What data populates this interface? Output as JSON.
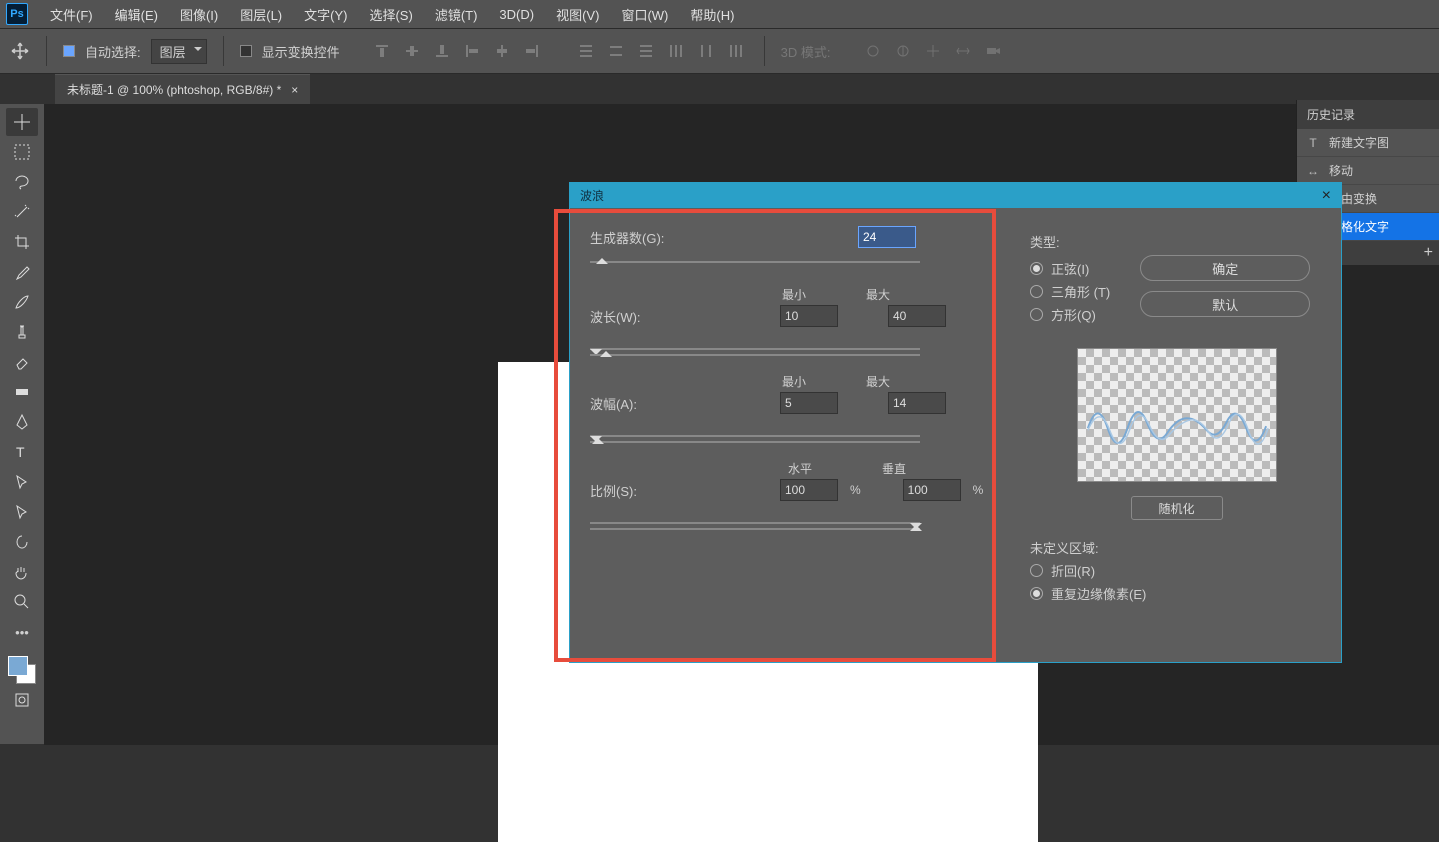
{
  "menu": {
    "items": [
      "文件(F)",
      "编辑(E)",
      "图像(I)",
      "图层(L)",
      "文字(Y)",
      "选择(S)",
      "滤镜(T)",
      "3D(D)",
      "视图(V)",
      "窗口(W)",
      "帮助(H)"
    ]
  },
  "optbar": {
    "auto_select": "自动选择:",
    "layer": "图层",
    "show_transform": "显示变换控件",
    "mode3d": "3D 模式:"
  },
  "tab": {
    "title": "未标题-1 @ 100% (phtoshop, RGB/8#) *",
    "close": "×"
  },
  "history": {
    "title": "历史记录",
    "items": [
      "新建文字图",
      "移动",
      "自由变换",
      "栅格化文字"
    ],
    "add": "+"
  },
  "dialog": {
    "title": "波浪",
    "close": "×",
    "generators_label": "生成器数(G):",
    "generators_value": "24",
    "wavelength_label": "波长(W):",
    "min": "最小",
    "max": "最大",
    "wl_min": "10",
    "wl_max": "40",
    "amplitude_label": "波幅(A):",
    "amp_min": "5",
    "amp_max": "14",
    "scale_label": "比例(S):",
    "horiz": "水平",
    "vert": "垂直",
    "scale_h": "100",
    "scale_v": "100",
    "pct": "%",
    "type_label": "类型:",
    "type_sine": "正弦(I)",
    "type_tri": "三角形 (T)",
    "type_sq": "方形(Q)",
    "ok": "确定",
    "default": "默认",
    "random": "随机化",
    "undef_label": "未定义区域:",
    "wrap": "折回(R)",
    "repeat": "重复边缘像素(E)"
  }
}
